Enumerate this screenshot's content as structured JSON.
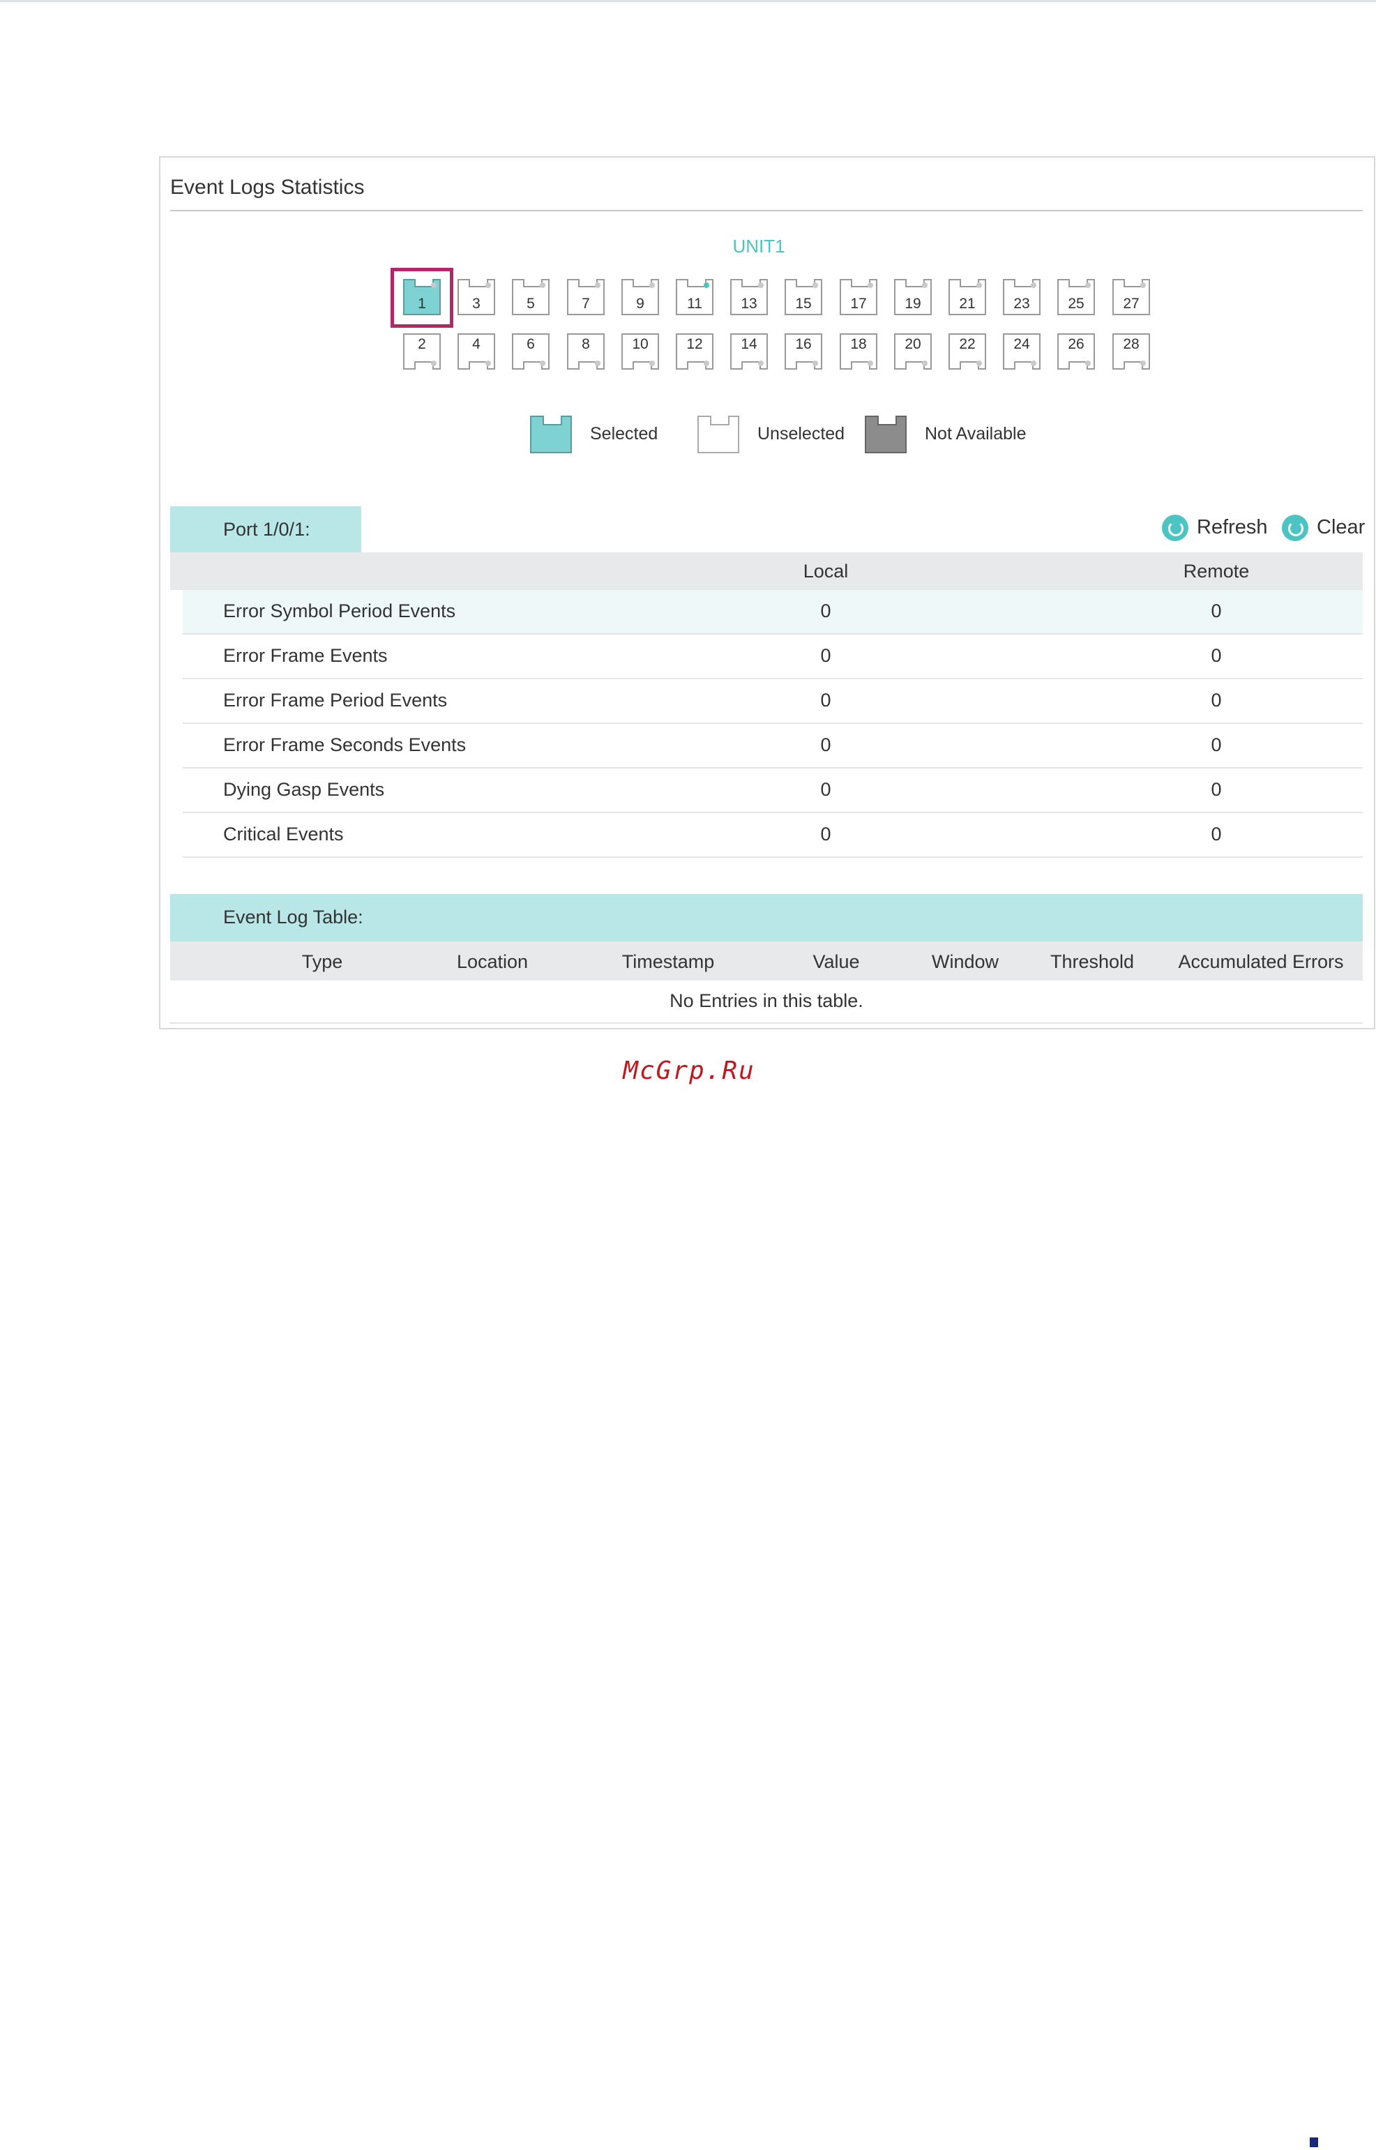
{
  "panel": {
    "title": "Event Logs Statistics"
  },
  "unit": {
    "label": "UNIT1"
  },
  "ports": {
    "top_row": [
      "1",
      "3",
      "5",
      "7",
      "9",
      "11",
      "13",
      "15",
      "17",
      "19",
      "21",
      "23",
      "25",
      "27"
    ],
    "bottom_row": [
      "2",
      "4",
      "6",
      "8",
      "10",
      "12",
      "14",
      "16",
      "18",
      "20",
      "22",
      "24",
      "26",
      "28"
    ],
    "selected": "1",
    "active_led": "11"
  },
  "legend": {
    "selected": "Selected",
    "unselected": "Unselected",
    "not_available": "Not Available"
  },
  "port_tab": {
    "label": "Port 1/0/1:"
  },
  "actions": {
    "refresh": "Refresh",
    "clear": "Clear"
  },
  "stats_table": {
    "columns": [
      "",
      "Local",
      "Remote"
    ],
    "rows": [
      {
        "name": "Error Symbol Period Events",
        "local": "0",
        "remote": "0"
      },
      {
        "name": "Error Frame Events",
        "local": "0",
        "remote": "0"
      },
      {
        "name": "Error Frame Period Events",
        "local": "0",
        "remote": "0"
      },
      {
        "name": "Error Frame Seconds Events",
        "local": "0",
        "remote": "0"
      },
      {
        "name": "Dying Gasp Events",
        "local": "0",
        "remote": "0"
      },
      {
        "name": "Critical Events",
        "local": "0",
        "remote": "0"
      }
    ]
  },
  "log_table": {
    "title": "Event Log Table:",
    "columns": [
      "Type",
      "Location",
      "Timestamp",
      "Value",
      "Window",
      "Threshold",
      "Accumulated Errors"
    ],
    "empty_text": "No Entries in this table."
  },
  "watermark": "McGrp.Ru",
  "colors": {
    "accent": "#4cc4c4",
    "tab_bg": "#b9e6e6",
    "selected_port": "#7fd2d2",
    "highlight_frame": "#b0286a",
    "not_available": "#8c8c8c"
  }
}
